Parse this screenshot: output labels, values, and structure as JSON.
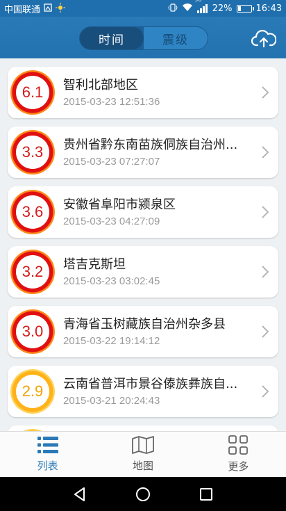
{
  "status_bar": {
    "carrier": "中国联通",
    "battery": "22%",
    "time": "16:43",
    "battery_level": 0.22,
    "icons": [
      "sim-icon",
      "sun-icon",
      "vibrate-icon",
      "wifi-icon",
      "signal-icon",
      "battery-icon"
    ],
    "network_tag": "3G"
  },
  "header": {
    "segments": [
      {
        "label": "时间",
        "active": true
      },
      {
        "label": "震级",
        "active": false
      }
    ],
    "upload_icon": "cloud-upload-icon"
  },
  "quakes": [
    {
      "magnitude": "6.1",
      "place": "智利北部地区",
      "time": "2015-03-23 12:51:36",
      "severity": "red"
    },
    {
      "magnitude": "3.3",
      "place": "贵州省黔东南苗族侗族自治州...",
      "time": "2015-03-23 07:27:07",
      "severity": "red"
    },
    {
      "magnitude": "3.6",
      "place": "安徽省阜阳市颍泉区",
      "time": "2015-03-23 04:27:09",
      "severity": "red"
    },
    {
      "magnitude": "3.2",
      "place": "塔吉克斯坦",
      "time": "2015-03-23 03:02:45",
      "severity": "red"
    },
    {
      "magnitude": "3.0",
      "place": "青海省玉树藏族自治州杂多县",
      "time": "2015-03-22 19:14:12",
      "severity": "red"
    },
    {
      "magnitude": "2.9",
      "place": "云南省普洱市景谷傣族彝族自...",
      "time": "2015-03-21 20:24:43",
      "severity": "orange"
    }
  ],
  "tabs": [
    {
      "label": "列表",
      "icon": "list-icon",
      "active": true
    },
    {
      "label": "地图",
      "icon": "map-icon",
      "active": false
    },
    {
      "label": "更多",
      "icon": "grid-icon",
      "active": false
    }
  ],
  "colors": {
    "header": "#2a7ab8",
    "severity_red": "#e01010",
    "severity_orange": "#ffb21a",
    "active_tab": "#2a7ab8"
  }
}
